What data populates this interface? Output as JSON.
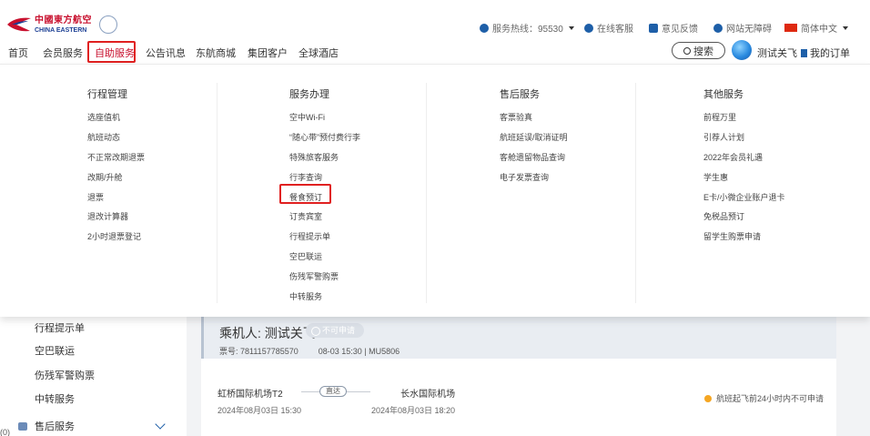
{
  "header": {
    "logo": {
      "cn": "中國東方航空",
      "en": "CHINA EASTERN"
    },
    "hotline": "服务热线：95530",
    "online_service": "在线客服",
    "feedback": "意见反馈",
    "accessibility": "网站无障碍",
    "language": "简体中文",
    "nav": [
      {
        "label": "首页"
      },
      {
        "label": "会员服务"
      },
      {
        "label": "自助服务"
      },
      {
        "label": "公告讯息"
      },
      {
        "label": "东航商城"
      },
      {
        "label": "集团客户"
      },
      {
        "label": "全球酒店"
      }
    ],
    "search_label": "搜索",
    "username": "测试关飞",
    "my_orders": "我的订单"
  },
  "mega_menu": {
    "columns": [
      {
        "title": "行程管理",
        "links": [
          "选座值机",
          "航班动态",
          "不正常改期退票",
          "改期/升舱",
          "退票",
          "退改计算器",
          "2小时退票登记"
        ]
      },
      {
        "title": "服务办理",
        "links": [
          "空中Wi-Fi",
          "“随心带”预付费行李",
          "特殊旅客服务",
          "行李查询",
          "餐食预订",
          "订贵宾室",
          "行程提示单",
          "空巴联运",
          "伤残军警购票",
          "中转服务"
        ]
      },
      {
        "title": "售后服务",
        "links": [
          "客票验真",
          "航班延误/取消证明",
          "客舱遗留物品查询",
          "电子发票查询"
        ]
      },
      {
        "title": "其他服务",
        "links": [
          "前程万里",
          "引荐人计划",
          "2022年会员礼遇",
          "学生惠",
          "E卡/小微企业账户退卡",
          "免税品预订",
          "留学生购票申请"
        ]
      }
    ]
  },
  "sidebar": {
    "items": [
      "行程提示单",
      "空巴联运",
      "伤残军警购票",
      "中转服务"
    ],
    "group": "售后服务",
    "badge": "(0)"
  },
  "card": {
    "passenger": "乘机人: 测试关飞",
    "status": "不可申请",
    "ticket_no": "票号: 7811157785570",
    "flight_info": "08-03 15:30 | MU5806",
    "departure": {
      "airport": "虹桥国际机场T2",
      "time": "2024年08月03日 15:30"
    },
    "direct": "直达",
    "arrival": {
      "airport": "长水国际机场",
      "time": "2024年08月03日 18:20"
    },
    "notice": "航班起飞前24小时内不可申请"
  },
  "colors": {
    "brand_red": "#c8102e",
    "brand_blue": "#1c3f94",
    "highlight_box": "#e02020"
  }
}
